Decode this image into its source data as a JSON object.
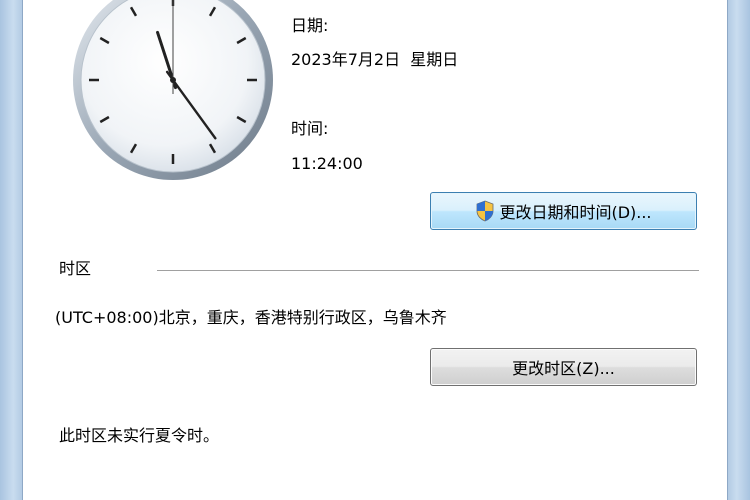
{
  "date_section": {
    "label": "日期:",
    "value": "2023年7月2日  星期日"
  },
  "time_section": {
    "label": "时间:",
    "value": "11:24:00"
  },
  "change_datetime_button": {
    "label": "更改日期和时间(D)...",
    "icon": "uac-shield-icon"
  },
  "timezone_section": {
    "heading": "时区",
    "current": "(UTC+08:00)北京，重庆，香港特别行政区，乌鲁木齐",
    "change_button_label": "更改时区(Z)...",
    "dst_note": "此时区未实行夏令时。"
  },
  "clock": {
    "hour": 11,
    "minute": 24,
    "second": 0
  }
}
